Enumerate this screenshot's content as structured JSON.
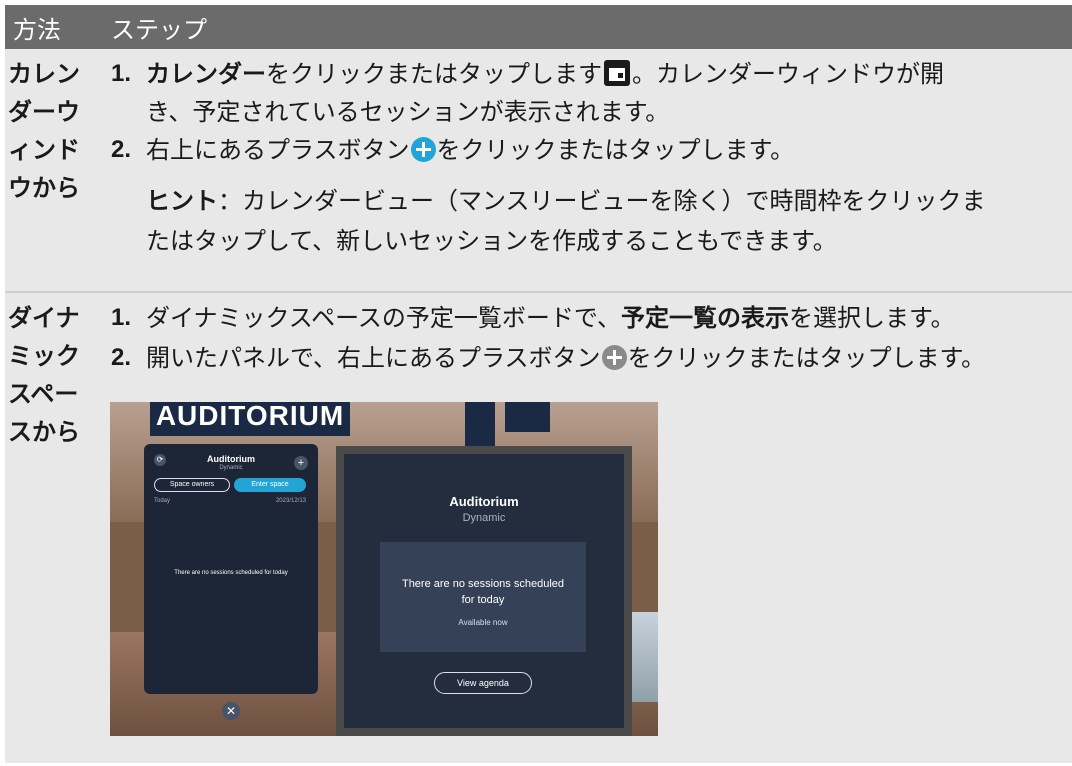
{
  "header": {
    "method": "方法",
    "steps": "ステップ"
  },
  "row1": {
    "method_lines": [
      "カレン",
      "ダーウ",
      "ィンド",
      "ウから"
    ],
    "step1": {
      "num": "1.",
      "bold": "カレンダー",
      "text_a": "をクリックまたはタップします",
      "text_b": "。カレンダーウィンドウが開",
      "line2": "き、予定されているセッションが表示されます。",
      "icon": "calendar-icon"
    },
    "step2": {
      "num": "2.",
      "text_a": "右上にあるプラスボタン",
      "text_b": "をクリックまたはタップします。",
      "icon": "plus-icon"
    },
    "hint": {
      "label": "ヒント",
      "line1": "：カレンダービュー（マンスリービューを除く）で時間枠をクリックま",
      "line2": "たはタップして、新しいセッションを作成することもできます。"
    }
  },
  "row2": {
    "method_lines": [
      "ダイナ",
      "ミック",
      "スペー",
      "スから"
    ],
    "step1": {
      "num": "1.",
      "text_a": "ダイナミックスペースの予定一覧ボードで、",
      "bold": "予定一覧の表示",
      "text_b": "を選択します。"
    },
    "step2": {
      "num": "2.",
      "text_a": "開いたパネルで、右上にあるプラスボタン",
      "text_b": "をクリックまたはタップします。",
      "icon": "plus-icon"
    }
  },
  "screenshot": {
    "banner": "AUDITORIUM",
    "left_panel": {
      "title": "Auditorium",
      "subtitle": "Dynamic",
      "space_owners": "Space owners",
      "enter_space": "Enter space",
      "today": "Today",
      "date": "2023/12/13",
      "empty": "There are no sessions scheduled for today"
    },
    "right_panel": {
      "title": "Auditorium",
      "subtitle": "Dynamic",
      "message_line1": "There are no sessions scheduled",
      "message_line2": "for today",
      "available": "Available now",
      "view_agenda": "View agenda"
    }
  }
}
